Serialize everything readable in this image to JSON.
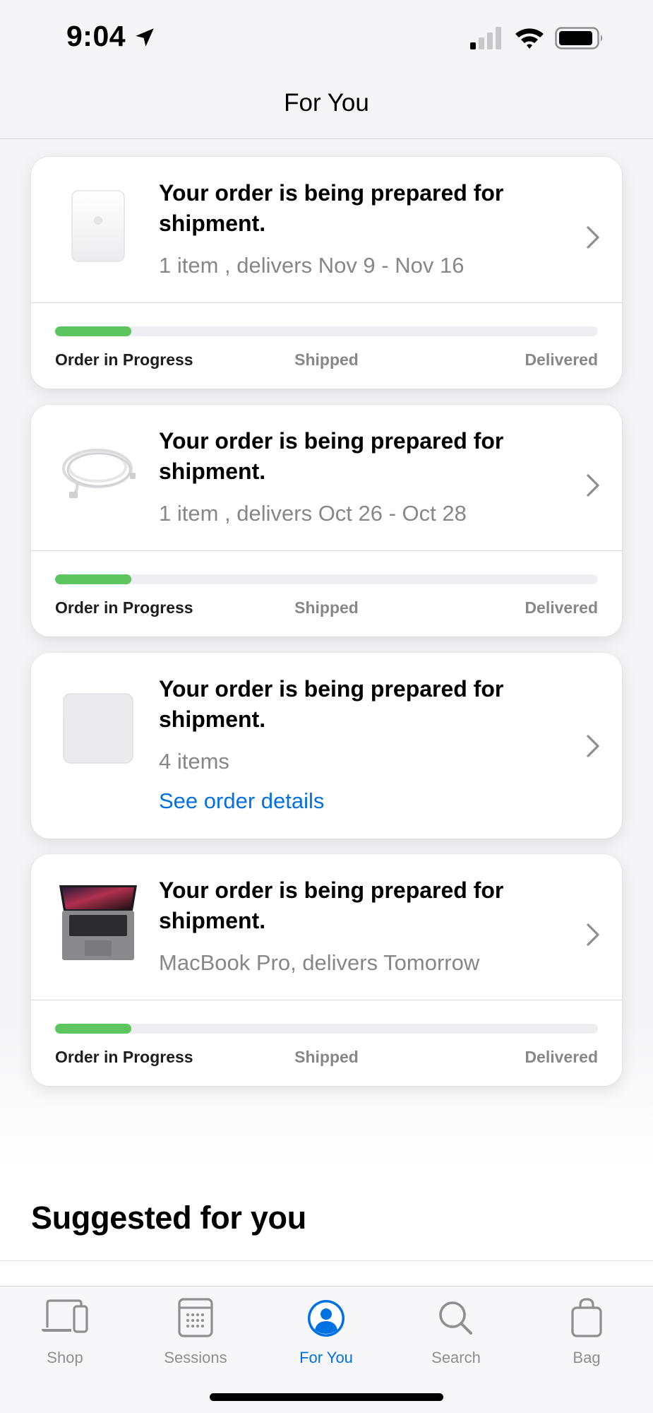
{
  "status_bar": {
    "time": "9:04"
  },
  "header": {
    "title": "For You"
  },
  "orders": [
    {
      "title": "Your order is being prepared for shipment.",
      "subtitle": "1 item , delivers Nov 9 - Nov 16",
      "thumbnail": "power-adapter-image",
      "progress_fraction": 0.14,
      "steps": [
        "Order in Progress",
        "Shipped",
        "Delivered"
      ]
    },
    {
      "title": "Your order is being prepared for shipment.",
      "subtitle": "1 item , delivers Oct 26 - Oct 28",
      "thumbnail": "charging-cable-image",
      "progress_fraction": 0.14,
      "steps": [
        "Order in Progress",
        "Shipped",
        "Delivered"
      ]
    },
    {
      "title": "Your order is being prepared for shipment.",
      "subtitle": "4 items",
      "link": "See order details",
      "thumbnail": "accessory-box-image"
    },
    {
      "title": "Your order is being prepared for shipment.",
      "subtitle": "MacBook Pro, delivers Tomorrow",
      "thumbnail": "macbook-pro-image",
      "progress_fraction": 0.14,
      "steps": [
        "Order in Progress",
        "Shipped",
        "Delivered"
      ]
    }
  ],
  "suggested": {
    "title": "Suggested for you"
  },
  "tabbar": {
    "items": [
      {
        "label": "Shop",
        "icon": "laptop-phone-icon"
      },
      {
        "label": "Sessions",
        "icon": "calendar-grid-icon"
      },
      {
        "label": "For You",
        "icon": "person-circle-icon",
        "active": true
      },
      {
        "label": "Search",
        "icon": "magnifier-icon"
      },
      {
        "label": "Bag",
        "icon": "shopping-bag-icon"
      }
    ]
  },
  "colors": {
    "accent": "#0071e3",
    "progress": "#5cc55f",
    "secondary_text": "#86868b",
    "background": "#f5f5f7"
  }
}
